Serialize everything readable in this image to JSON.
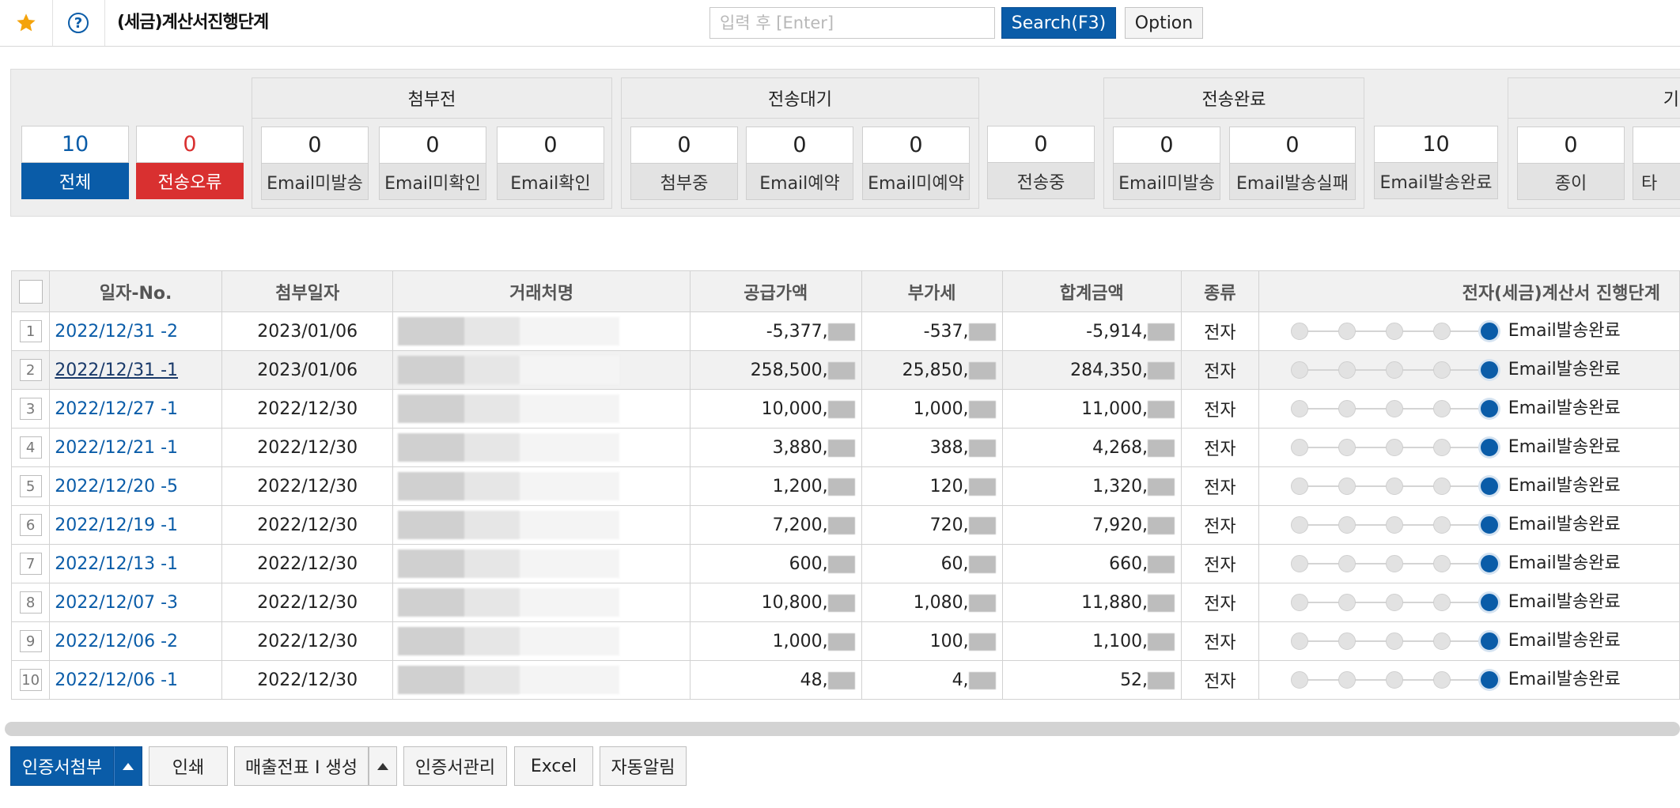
{
  "header": {
    "title": "(세금)계산서진행단계",
    "search_placeholder": "입력 후 [Enter]",
    "search_button": "Search(F3)",
    "option_button": "Option",
    "icons": [
      "star-icon",
      "help-icon"
    ]
  },
  "summary": {
    "total": {
      "value": "10",
      "label": "전체"
    },
    "error": {
      "value": "0",
      "label": "전송오류"
    },
    "groups": [
      {
        "title": "첨부전",
        "items": [
          {
            "value": "0",
            "label": "Email미발송"
          },
          {
            "value": "0",
            "label": "Email미확인"
          },
          {
            "value": "0",
            "label": "Email확인"
          }
        ]
      },
      {
        "title": "전송대기",
        "items": [
          {
            "value": "0",
            "label": "첨부중"
          },
          {
            "value": "0",
            "label": "Email예약"
          },
          {
            "value": "0",
            "label": "Email미예약"
          }
        ]
      },
      {
        "title": "전송완료",
        "items": [
          {
            "value": "0",
            "label": "Email미발송"
          },
          {
            "value": "0",
            "label": "Email발송실패"
          }
        ]
      },
      {
        "title": "기",
        "items": [
          {
            "value": "0",
            "label": "종이"
          },
          {
            "value": "",
            "label": "타"
          }
        ]
      }
    ],
    "standalone": [
      {
        "value": "0",
        "label": "전송중"
      },
      {
        "value": "10",
        "label": "Email발송완료"
      }
    ]
  },
  "table": {
    "columns": [
      "일자-No.",
      "첨부일자",
      "거래처명",
      "공급가액",
      "부가세",
      "합계금액",
      "종류",
      "전자(세금)계산서 진행단계"
    ],
    "rows": [
      {
        "no": "1",
        "date_no": "2022/12/31 -2",
        "attach_date": "2023/01/06",
        "supply": "-5,377,",
        "vat": "-537,",
        "total": "-5,914,",
        "kind": "전자",
        "status": "Email발송완료",
        "step": 5
      },
      {
        "no": "2",
        "date_no": "2022/12/31 -1",
        "attach_date": "2023/01/06",
        "supply": "258,500,",
        "vat": "25,850,",
        "total": "284,350,",
        "kind": "전자",
        "status": "Email발송완료",
        "step": 5
      },
      {
        "no": "3",
        "date_no": "2022/12/27 -1",
        "attach_date": "2022/12/30",
        "supply": "10,000,",
        "vat": "1,000,",
        "total": "11,000,",
        "kind": "전자",
        "status": "Email발송완료",
        "step": 5
      },
      {
        "no": "4",
        "date_no": "2022/12/21 -1",
        "attach_date": "2022/12/30",
        "supply": "3,880,",
        "vat": "388,",
        "total": "4,268,",
        "kind": "전자",
        "status": "Email발송완료",
        "step": 5
      },
      {
        "no": "5",
        "date_no": "2022/12/20 -5",
        "attach_date": "2022/12/30",
        "supply": "1,200,",
        "vat": "120,",
        "total": "1,320,",
        "kind": "전자",
        "status": "Email발송완료",
        "step": 5
      },
      {
        "no": "6",
        "date_no": "2022/12/19 -1",
        "attach_date": "2022/12/30",
        "supply": "7,200,",
        "vat": "720,",
        "total": "7,920,",
        "kind": "전자",
        "status": "Email발송완료",
        "step": 5
      },
      {
        "no": "7",
        "date_no": "2022/12/13 -1",
        "attach_date": "2022/12/30",
        "supply": "600,",
        "vat": "60,",
        "total": "660,",
        "kind": "전자",
        "status": "Email발송완료",
        "step": 5
      },
      {
        "no": "8",
        "date_no": "2022/12/07 -3",
        "attach_date": "2022/12/30",
        "supply": "10,800,",
        "vat": "1,080,",
        "total": "11,880,",
        "kind": "전자",
        "status": "Email발송완료",
        "step": 5
      },
      {
        "no": "9",
        "date_no": "2022/12/06 -2",
        "attach_date": "2022/12/30",
        "supply": "1,000,",
        "vat": "100,",
        "total": "1,100,",
        "kind": "전자",
        "status": "Email발송완료",
        "step": 5
      },
      {
        "no": "10",
        "date_no": "2022/12/06 -1",
        "attach_date": "2022/12/30",
        "supply": "48,",
        "vat": "4,",
        "total": "52,",
        "kind": "전자",
        "status": "Email발송완료",
        "step": 5
      }
    ]
  },
  "toolbar": {
    "attach_cert": "인증서첨부",
    "print": "인쇄",
    "sales_slip": "매출전표 I 생성",
    "cert_manage": "인증서관리",
    "excel": "Excel",
    "auto_alert": "자동알림"
  },
  "colors": {
    "accent": "#0a5ca8",
    "error": "#d93030",
    "star": "#f4a30b"
  }
}
